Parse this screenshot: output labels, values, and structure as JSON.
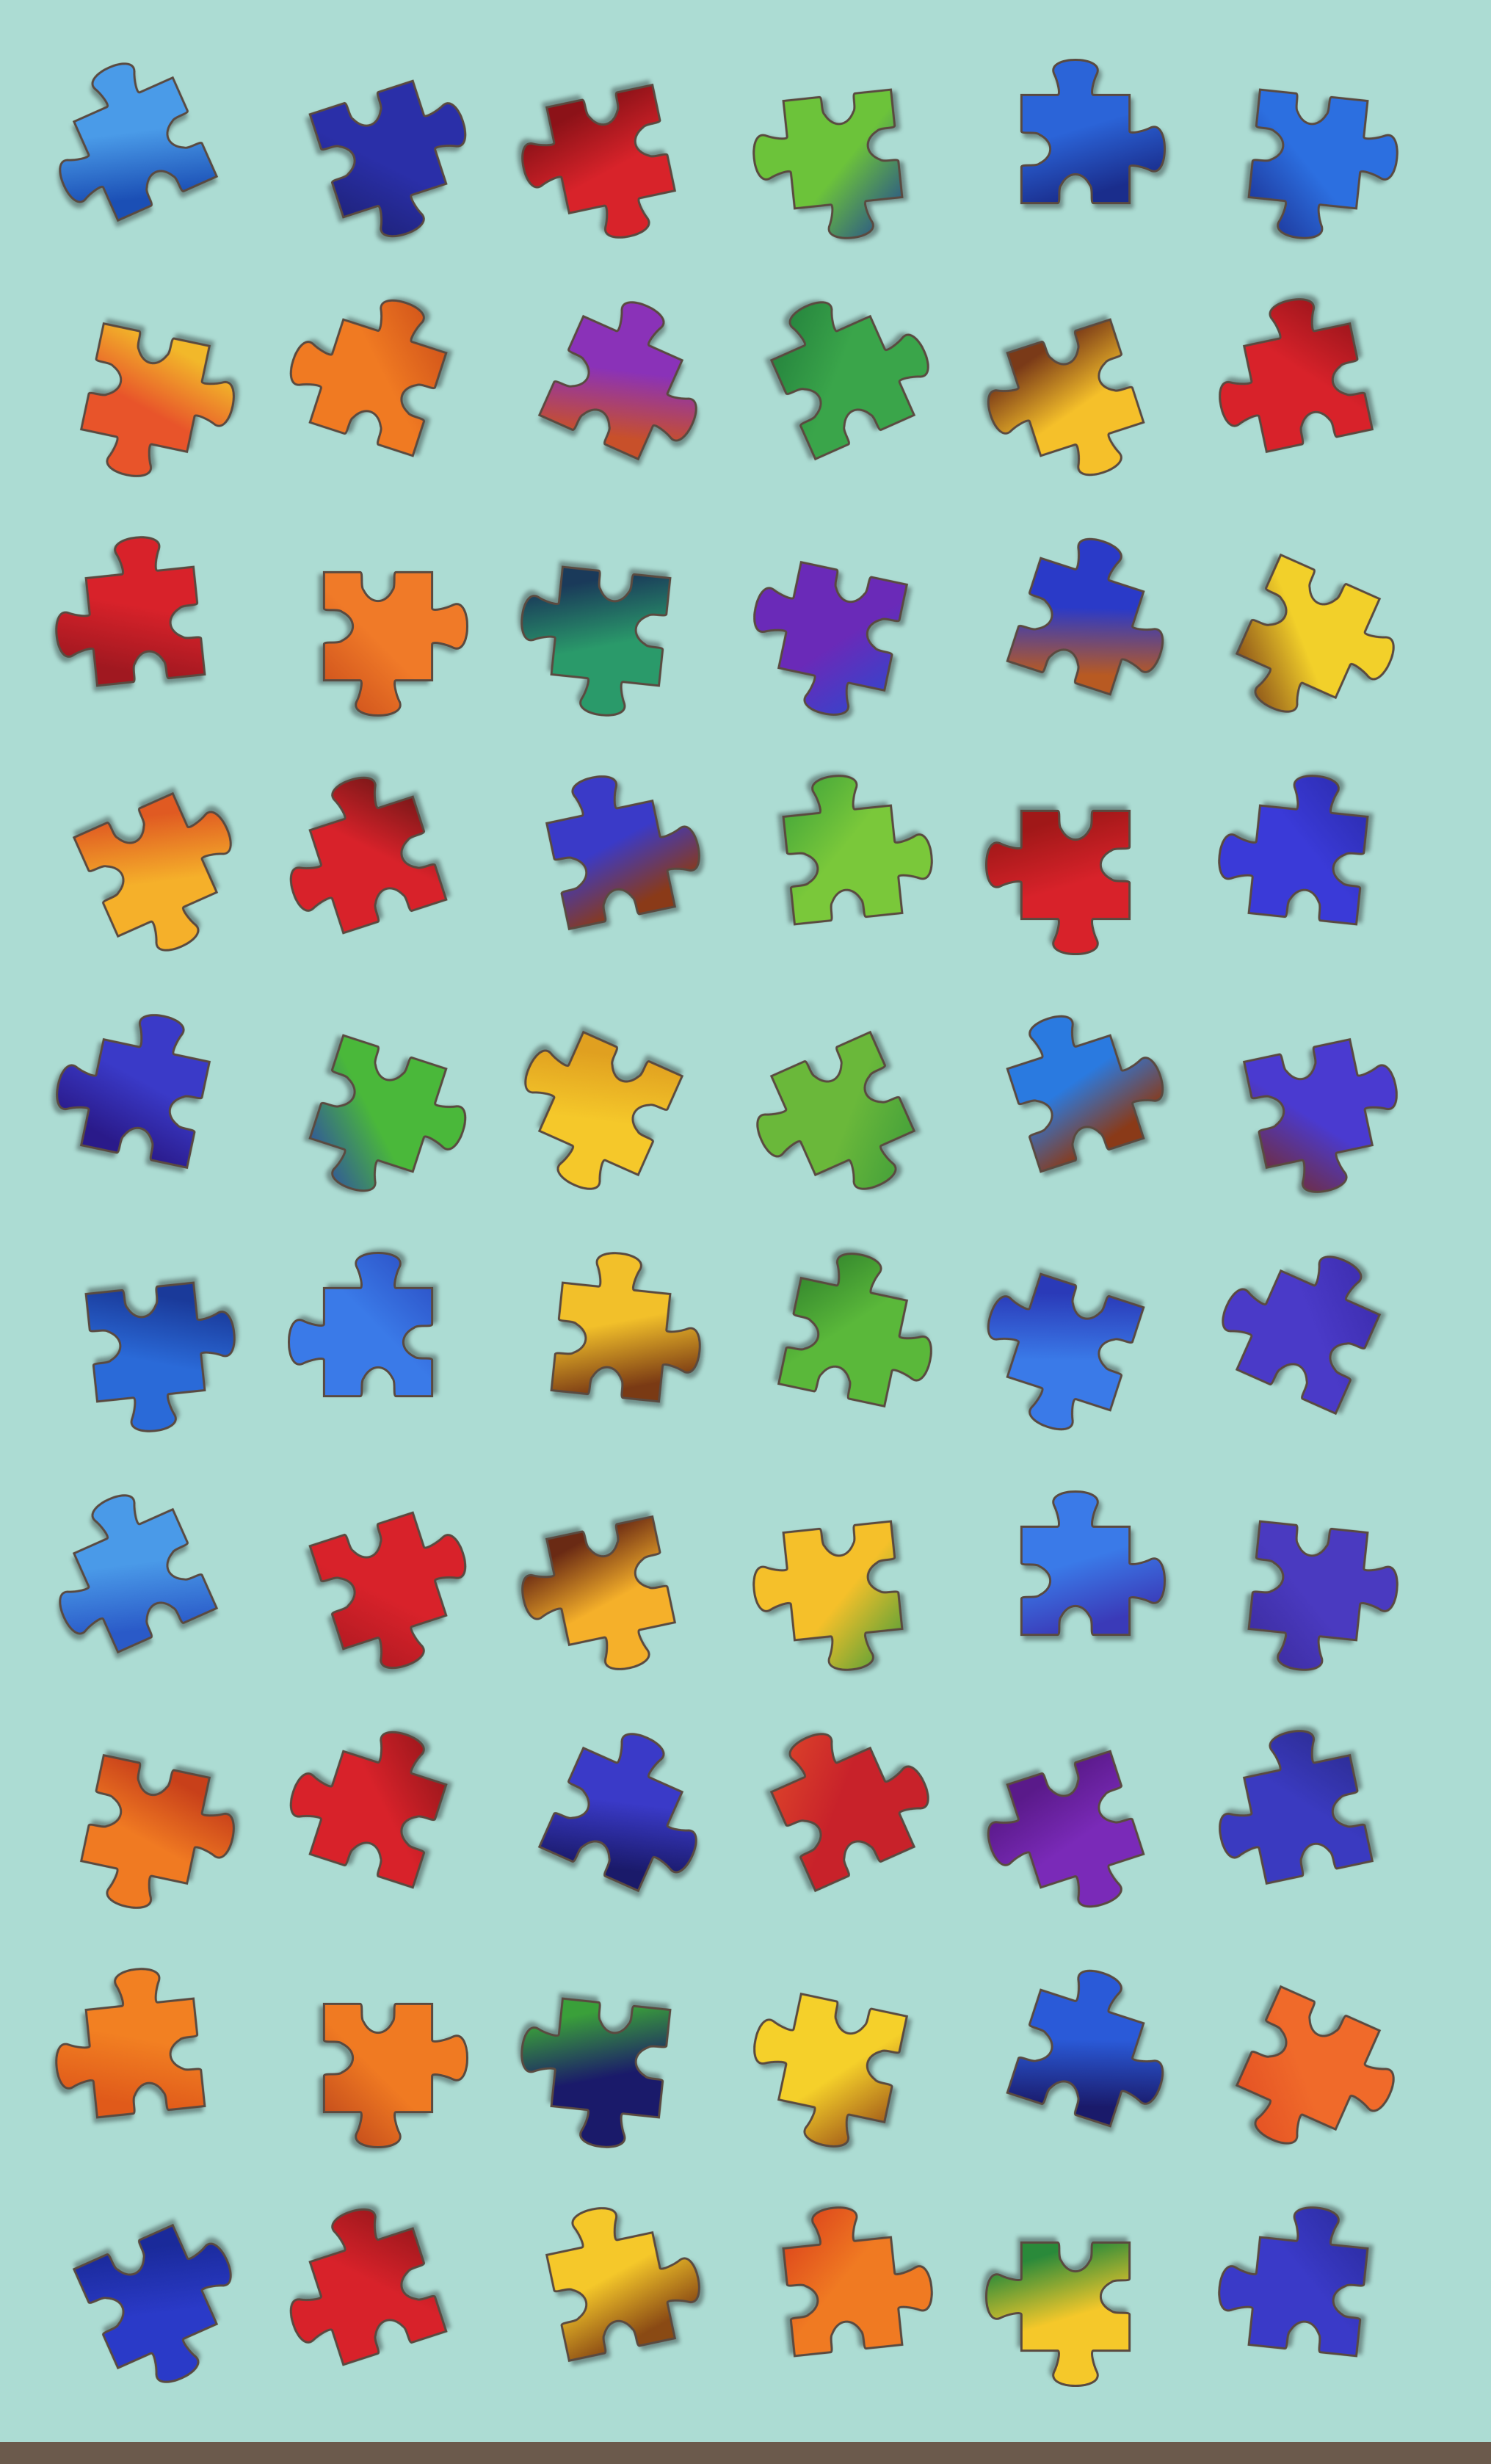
{
  "background": "#acdcd3",
  "edge_color": "#6b5a4c",
  "pieces": [
    [
      "#4a9be8",
      "#1b4fb5"
    ],
    [
      "#2a2fa8",
      "#1b1f6e"
    ],
    [
      "#d8232a",
      "#8c1218"
    ],
    [
      "#6cc33a",
      "#1c3e9a"
    ],
    [
      "#2b64d8",
      "#1a2d8c"
    ],
    [
      "#2c6fe0",
      "#1a2a8a"
    ],
    [
      "#e8542a",
      "#f2b82a"
    ],
    [
      "#f07a22",
      "#c94a18"
    ],
    [
      "#8a32b8",
      "#c8502a"
    ],
    [
      "#3aa54a",
      "#1f7a3a"
    ],
    [
      "#f5c02a",
      "#7a3a18"
    ],
    [
      "#d8222a",
      "#8c1218"
    ],
    [
      "#d8222a",
      "#a01820"
    ],
    [
      "#f07a28",
      "#c84a1a"
    ],
    [
      "#2a9a6a",
      "#1a3a5a"
    ],
    [
      "#6a2ab8",
      "#2a4ad0"
    ],
    [
      "#2a3ac8",
      "#b85a22"
    ],
    [
      "#f2d02a",
      "#6a2a14"
    ],
    [
      "#f5b02a",
      "#e05a22"
    ],
    [
      "#d8222a",
      "#5a1412"
    ],
    [
      "#3a3ac8",
      "#8a3a18"
    ],
    [
      "#7ac83a",
      "#3aa03a"
    ],
    [
      "#d8222a",
      "#a01818"
    ],
    [
      "#3a3ad8",
      "#2a2aa8"
    ],
    [
      "#3a3ac8",
      "#2a1a8a"
    ],
    [
      "#4ab83a",
      "#2a3ab8"
    ],
    [
      "#f5c82a",
      "#e0a020"
    ],
    [
      "#6ab83a",
      "#3a9a3a"
    ],
    [
      "#2a7ae0",
      "#8a3a18"
    ],
    [
      "#4a3ad0",
      "#7a2a18"
    ],
    [
      "#2a6ad8",
      "#1a3a9a"
    ],
    [
      "#3a7ae8",
      "#2a4ac0"
    ],
    [
      "#f2c02a",
      "#7a3a14"
    ],
    [
      "#5ab83a",
      "#2a7a2a"
    ],
    [
      "#3a7ae8",
      "#2a3ab8"
    ],
    [
      "#4a3ac8",
      "#3a2aa8"
    ],
    [
      "#4a9ae8",
      "#2a5ac8"
    ],
    [
      "#d8222a",
      "#a81820"
    ],
    [
      "#f5b02a",
      "#6a2a14"
    ],
    [
      "#f5c02a",
      "#3a9a3a"
    ],
    [
      "#3a7ae8",
      "#3a3ab8"
    ],
    [
      "#4a3ac0",
      "#3a2a9a"
    ],
    [
      "#f07a22",
      "#c8401a"
    ],
    [
      "#d8222a",
      "#8a1418"
    ],
    [
      "#3a3ac8",
      "#1a1a6a"
    ],
    [
      "#c8222a",
      "#e04a2a"
    ],
    [
      "#7a2ab8",
      "#5a1a8a"
    ],
    [
      "#3a3ac0",
      "#2a2a8a"
    ],
    [
      "#f28022",
      "#e05a1a"
    ],
    [
      "#f07a22",
      "#b8401a"
    ],
    [
      "#1a1a6a",
      "#3aa03a"
    ],
    [
      "#f5d02a",
      "#8a3a14"
    ],
    [
      "#2a5ad8",
      "#1a1a6a"
    ],
    [
      "#f06a2a",
      "#e04a22"
    ],
    [
      "#2a3ac8",
      "#1a2a9a"
    ],
    [
      "#d8222a",
      "#8a1418"
    ],
    [
      "#f5c82a",
      "#8a4a14"
    ],
    [
      "#f07a22",
      "#d83a1a"
    ],
    [
      "#f5c82a",
      "#2a8a3a"
    ],
    [
      "#3a3ac8",
      "#2a2a9a"
    ]
  ]
}
